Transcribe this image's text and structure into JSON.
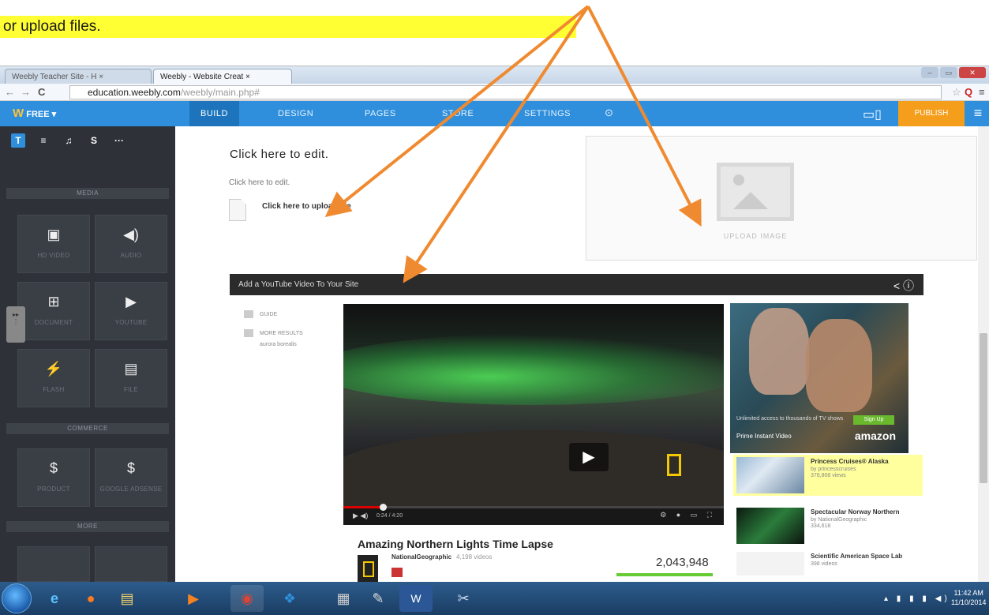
{
  "caption": {
    "text": "or upload files."
  },
  "browser": {
    "tabs": [
      {
        "label": "Weebly Teacher Site - H"
      },
      {
        "label": "Weebly - Website Creat"
      }
    ],
    "url_host": "education.weebly.com",
    "url_path": "/weebly/main.php#"
  },
  "topbar": {
    "plan": "FREE ▾",
    "menu": [
      "BUILD",
      "DESIGN",
      "PAGES",
      "STORE",
      "SETTINGS"
    ],
    "publish": "PUBLISH"
  },
  "sidebar": {
    "tabs": [
      "T",
      "≡",
      "♫",
      "S",
      "···"
    ],
    "sections": {
      "media": "MEDIA",
      "commerce": "COMMERCE",
      "more": "MORE"
    },
    "media_items": [
      {
        "icon": "hd-video-icon",
        "glyph": "▣",
        "label": "HD VIDEO"
      },
      {
        "icon": "audio-icon",
        "glyph": "◀)",
        "label": "AUDIO"
      },
      {
        "icon": "document-icon",
        "glyph": "⊞",
        "label": "DOCUMENT"
      },
      {
        "icon": "youtube-icon",
        "glyph": "▶",
        "label": "YOUTUBE"
      },
      {
        "icon": "flash-icon",
        "glyph": "⚡",
        "label": "FLASH"
      },
      {
        "icon": "file-icon",
        "glyph": "▤",
        "label": "FILE"
      }
    ],
    "commerce_items": [
      {
        "icon": "product-icon",
        "glyph": "$",
        "label": "PRODUCT"
      },
      {
        "icon": "google-adsense-icon",
        "glyph": "$",
        "label": "GOOGLE ADSENSE"
      }
    ]
  },
  "canvas": {
    "heading": "Click here to edit.",
    "paragraph": "Click here to edit.",
    "file_upload": "Click here to upload file",
    "image_upload": "UPLOAD IMAGE",
    "youtube_bar": "Add a YouTube Video To Your Site"
  },
  "youtube": {
    "guide": [
      "GUIDE",
      "MORE RESULTS"
    ],
    "more_results_sub": "aurora borealis",
    "video_title": "Amazing Northern Lights Time Lapse",
    "channel": "NationalGeographic",
    "channel_videos": "4,198 videos",
    "time": "0:24 / 4:20",
    "views": "2,043,948",
    "progress_fraction": 0.1,
    "ad": {
      "text": "Unlimited access to thousands of TV shows",
      "prime": "Prime Instant Video",
      "brand": "amazon",
      "signup": "Sign Up"
    },
    "related": [
      {
        "title": "Princess Cruises® Alaska",
        "by": "by princesscruises",
        "views": "378,808 views"
      },
      {
        "title": "Spectacular Norway Northern",
        "by": "by NationalGeographic",
        "views": "334,618"
      },
      {
        "title": "Scientific American Space Lab",
        "by": "",
        "views": "398 videos"
      }
    ]
  },
  "taskbar": {
    "clock_time": "11:42 AM",
    "clock_date": "11/10/2014"
  },
  "colors": {
    "accent": "#2f8fdc",
    "publish": "#f59e1b",
    "arrow": "#f08a30",
    "highlight": "#ffff33"
  }
}
